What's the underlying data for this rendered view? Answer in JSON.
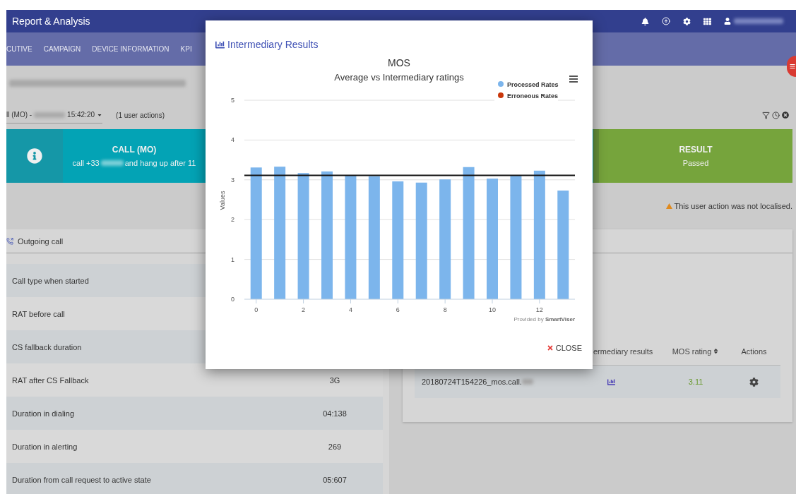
{
  "header": {
    "title": "Report & Analysis"
  },
  "nav": {
    "tabs": [
      {
        "label": "CUTIVE"
      },
      {
        "label": "CAMPAIGN"
      },
      {
        "label": "DEVICE INFORMATION"
      },
      {
        "label": "KPI"
      }
    ]
  },
  "action_select": {
    "prefix": "ll (MO) -",
    "time": "15:42:20"
  },
  "user_actions": "(1 user actions)",
  "banner": {
    "call_title": "CALL (MO)",
    "call_text_start": "call +33",
    "call_text_end": "and hang up after 11",
    "result_title": "RESULT",
    "result_value": "Passed"
  },
  "warning": "This user action was not localised.",
  "details": {
    "title": "Outgoing call",
    "rows": [
      {
        "label": "Call type when started"
      },
      {
        "label": "RAT before call"
      },
      {
        "label": "CS fallback duration"
      },
      {
        "label": "RAT after CS Fallback",
        "value": "3G"
      },
      {
        "label": "Duration in dialing",
        "value": "04:138"
      },
      {
        "label": "Duration in alerting",
        "value": "269"
      },
      {
        "label": "Duration from call request to active state",
        "value": "05:607"
      }
    ]
  },
  "results_table": {
    "columns": [
      {
        "label": "ermediary results",
        "sortable": false
      },
      {
        "label": "MOS rating",
        "sortable": true
      },
      {
        "label": "Actions",
        "sortable": false
      }
    ],
    "rows": [
      {
        "file": "20180724T154226_mos.call.",
        "mos": "3.11"
      }
    ]
  },
  "modal": {
    "title": "Intermediary Results",
    "subtitle": "Average vs Intermediary ratings",
    "credit_prefix": "Provided by",
    "credit_brand": "SmartViser",
    "close_label": "CLOSE",
    "chart_data": {
      "type": "bar",
      "title": "MOS",
      "ylabel": "Values",
      "x": [
        0,
        1,
        2,
        3,
        4,
        5,
        6,
        7,
        8,
        9,
        10,
        11,
        12,
        13
      ],
      "grid": true,
      "series": [
        {
          "name": "Processed Rates",
          "color": "#7cb5ec",
          "values": [
            3.31,
            3.33,
            3.17,
            3.21,
            3.1,
            3.09,
            2.96,
            2.93,
            3.01,
            3.32,
            3.03,
            3.1,
            3.23,
            2.73
          ]
        },
        {
          "name": "Erroneous Rates",
          "color": "#c9370b",
          "values": [
            null,
            null,
            null,
            null,
            null,
            null,
            null,
            null,
            null,
            null,
            null,
            null,
            null,
            null
          ]
        }
      ],
      "xlim": [
        -0.5,
        13.5
      ],
      "ylim": [
        0,
        5
      ],
      "xticks": [
        0,
        2,
        4,
        6,
        8,
        10,
        12
      ],
      "yticks": [
        0,
        1,
        2,
        3,
        4,
        5
      ],
      "ref_lines": [
        {
          "axis": "y",
          "value": 3.11
        }
      ]
    }
  }
}
